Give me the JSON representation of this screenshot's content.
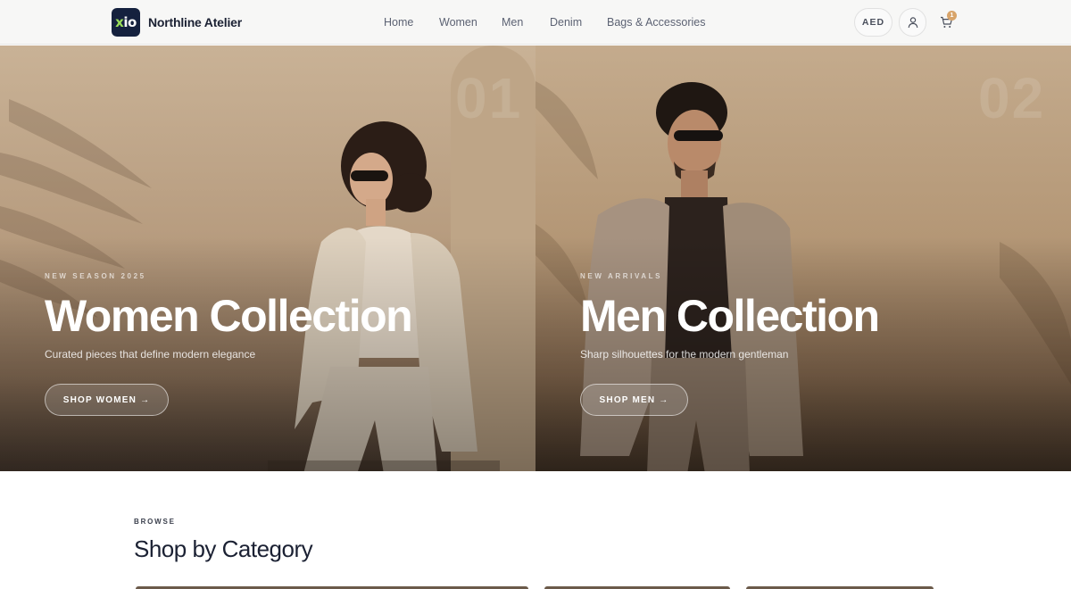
{
  "header": {
    "logo_text": "xio",
    "brand": "Northline Atelier",
    "nav": [
      "Home",
      "Women",
      "Men",
      "Denim",
      "Bags & Accessories"
    ],
    "currency": "AED",
    "cart_count": "1",
    "icons": {
      "account": "user-icon",
      "cart": "cart-icon"
    }
  },
  "hero": {
    "women": {
      "number": "01",
      "eyebrow": "NEW SEASON 2025",
      "title": "Women Collection",
      "subtitle": "Curated pieces that define modern elegance",
      "cta": "SHOP WOMEN →"
    },
    "men": {
      "number": "02",
      "eyebrow": "NEW ARRIVALS",
      "title": "Men Collection",
      "subtitle": "Sharp silhouettes for the modern gentleman",
      "cta": "SHOP MEN →"
    }
  },
  "categories": {
    "eyebrow": "BROWSE",
    "title": "Shop by Category"
  },
  "colors": {
    "accent": "#d8a46a",
    "ink": "#1b2133",
    "logo_bg": "#15213e"
  }
}
